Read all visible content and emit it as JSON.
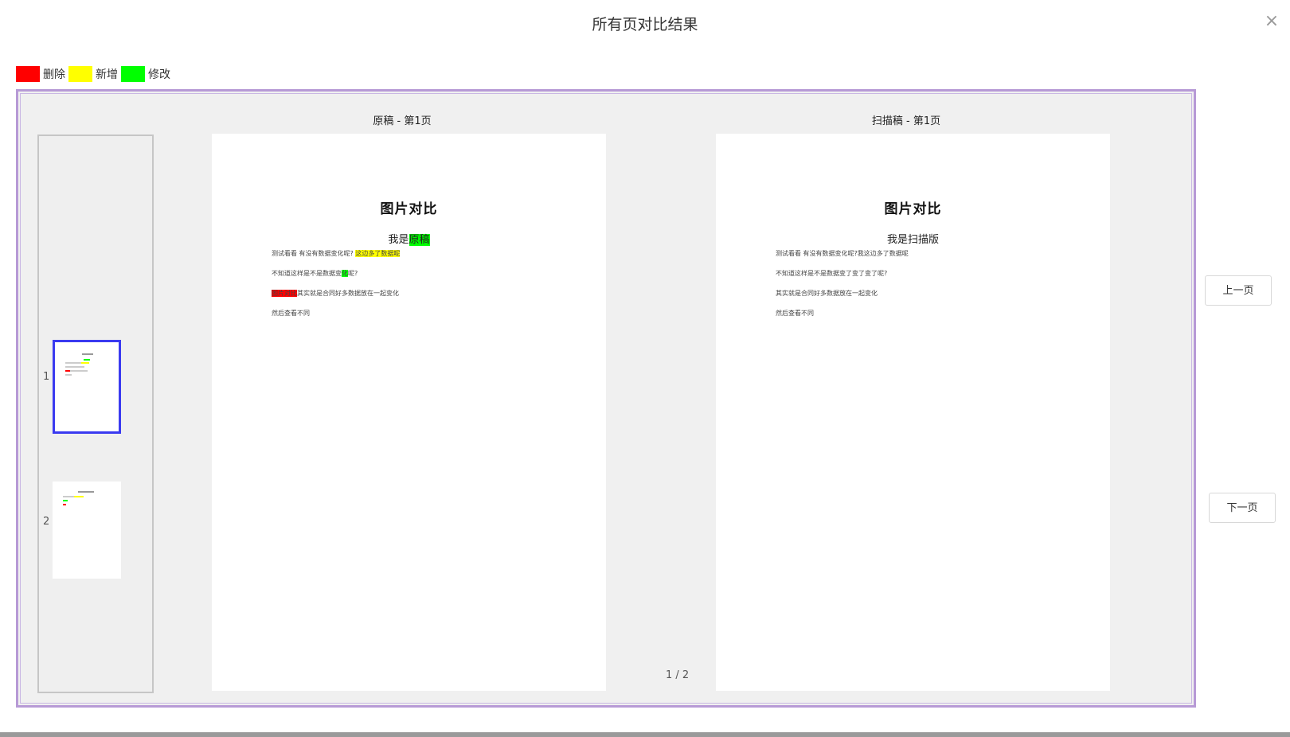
{
  "dialog": {
    "title": "所有页对比结果",
    "close_icon": "close-icon"
  },
  "legend": [
    {
      "label": "删除",
      "color": "#ff0000"
    },
    {
      "label": "新增",
      "color": "#ffff00"
    },
    {
      "label": "修改",
      "color": "#00ff00"
    }
  ],
  "thumbnails": [
    {
      "number": "1",
      "selected": true
    },
    {
      "number": "2",
      "selected": false
    }
  ],
  "left_page": {
    "header": "原稿 - 第1页",
    "title": "图片对比",
    "subtitle_pre": "我是",
    "subtitle_hl": "原稿",
    "line1_pre": "测试看看  有没有数据变化呢?  ",
    "line1_hl": "这边多了数据呢",
    "line2_pre": "不知道这样是不是数据变",
    "line2_hl": "化",
    "line2_post": "呢?",
    "line3_hl": "图片对比",
    "line3_post": "其实就是合同好多数据放在一起变化",
    "line4": "然后查看不同"
  },
  "right_page": {
    "header": "扫描稿 - 第1页",
    "title": "图片对比",
    "subtitle": "我是扫描版",
    "line1": "测试看看  有没有数据变化呢?我这边多了数据呢",
    "line2": "不知道这样是不是数据变了变了变了呢?",
    "line3": "其实就是合同好多数据放在一起变化",
    "line4": "然后查看不同"
  },
  "pager": {
    "counter": "1 / 2",
    "prev_label": "上一页",
    "next_label": "下一页"
  }
}
